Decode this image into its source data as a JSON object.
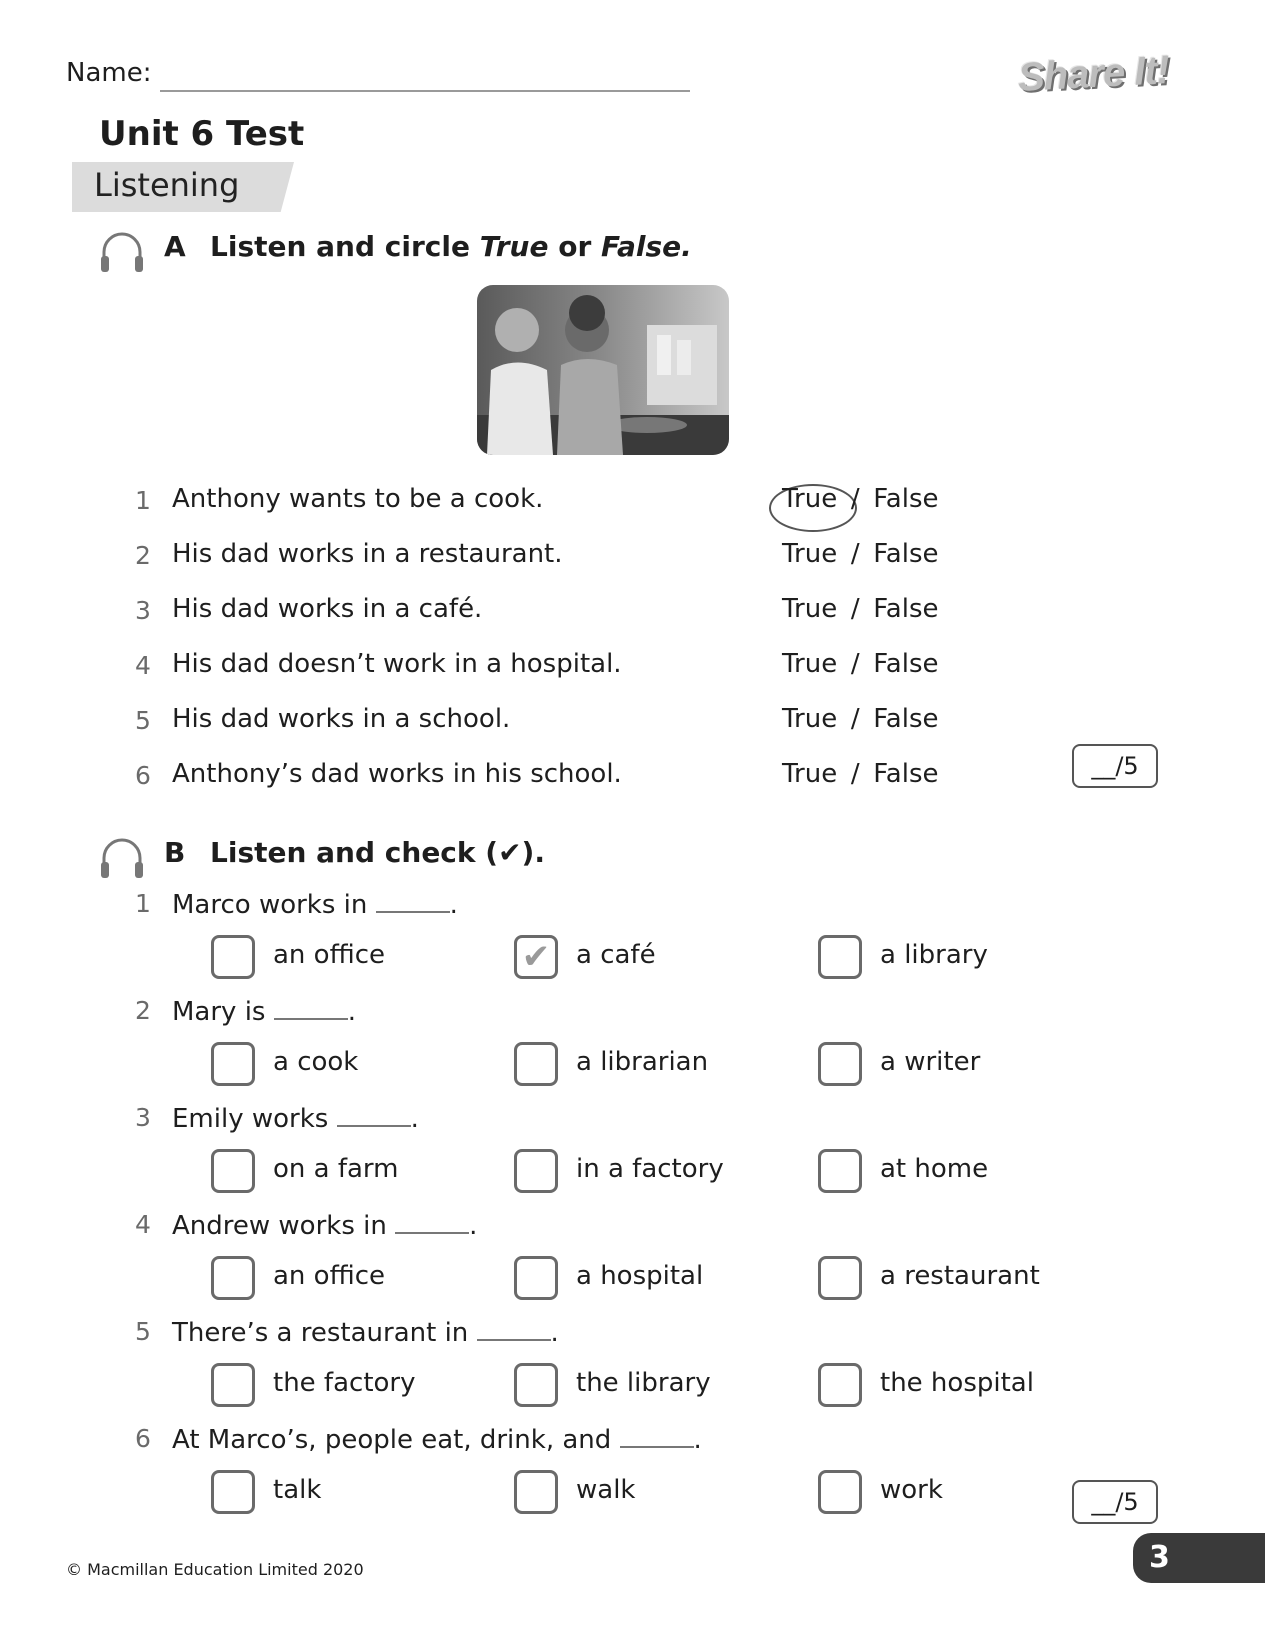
{
  "header": {
    "name_label": "Name:",
    "logo_text": "Share It!",
    "title": "Unit 6 Test",
    "section": "Listening"
  },
  "exercise_a": {
    "letter": "A",
    "instruction_start": "Listen and circle ",
    "instruction_true": "True",
    "instruction_or": " or ",
    "instruction_false": "False.",
    "true_label": "True",
    "sep": "/",
    "false_label": "False",
    "items": [
      {
        "num": "1",
        "text": "Anthony wants to be a cook.",
        "circled": "True"
      },
      {
        "num": "2",
        "text": "His dad works in a restaurant."
      },
      {
        "num": "3",
        "text": "His dad works in a café."
      },
      {
        "num": "4",
        "text": "His dad doesn’t work in a hospital."
      },
      {
        "num": "5",
        "text": "His dad works in a school."
      },
      {
        "num": "6",
        "text": "Anthony’s dad works in his school."
      }
    ],
    "score": "__/5"
  },
  "exercise_b": {
    "letter": "B",
    "instruction": "Listen and check (✔).",
    "items": [
      {
        "num": "1",
        "before": "Marco works in ",
        "after": ".",
        "options": [
          "an office",
          "a café",
          "a library"
        ],
        "checked": 1
      },
      {
        "num": "2",
        "before": "Mary is ",
        "after": ".",
        "options": [
          "a cook",
          "a librarian",
          "a writer"
        ]
      },
      {
        "num": "3",
        "before": "Emily works ",
        "after": ".",
        "options": [
          "on a farm",
          "in a factory",
          "at home"
        ]
      },
      {
        "num": "4",
        "before": "Andrew works in ",
        "after": ".",
        "options": [
          "an office",
          "a hospital",
          "a restaurant"
        ]
      },
      {
        "num": "5",
        "before": "There’s a restaurant in ",
        "after": ".",
        "options": [
          "the factory",
          "the library",
          "the hospital"
        ]
      },
      {
        "num": "6",
        "before": "At Marco’s, people eat, drink, and ",
        "after": ".",
        "options": [
          "talk",
          "walk",
          "work"
        ]
      }
    ],
    "check_mark": "✔",
    "score": "__/5"
  },
  "footer": {
    "copyright": "© Macmillan Education Limited 2020",
    "page_number": "3"
  }
}
